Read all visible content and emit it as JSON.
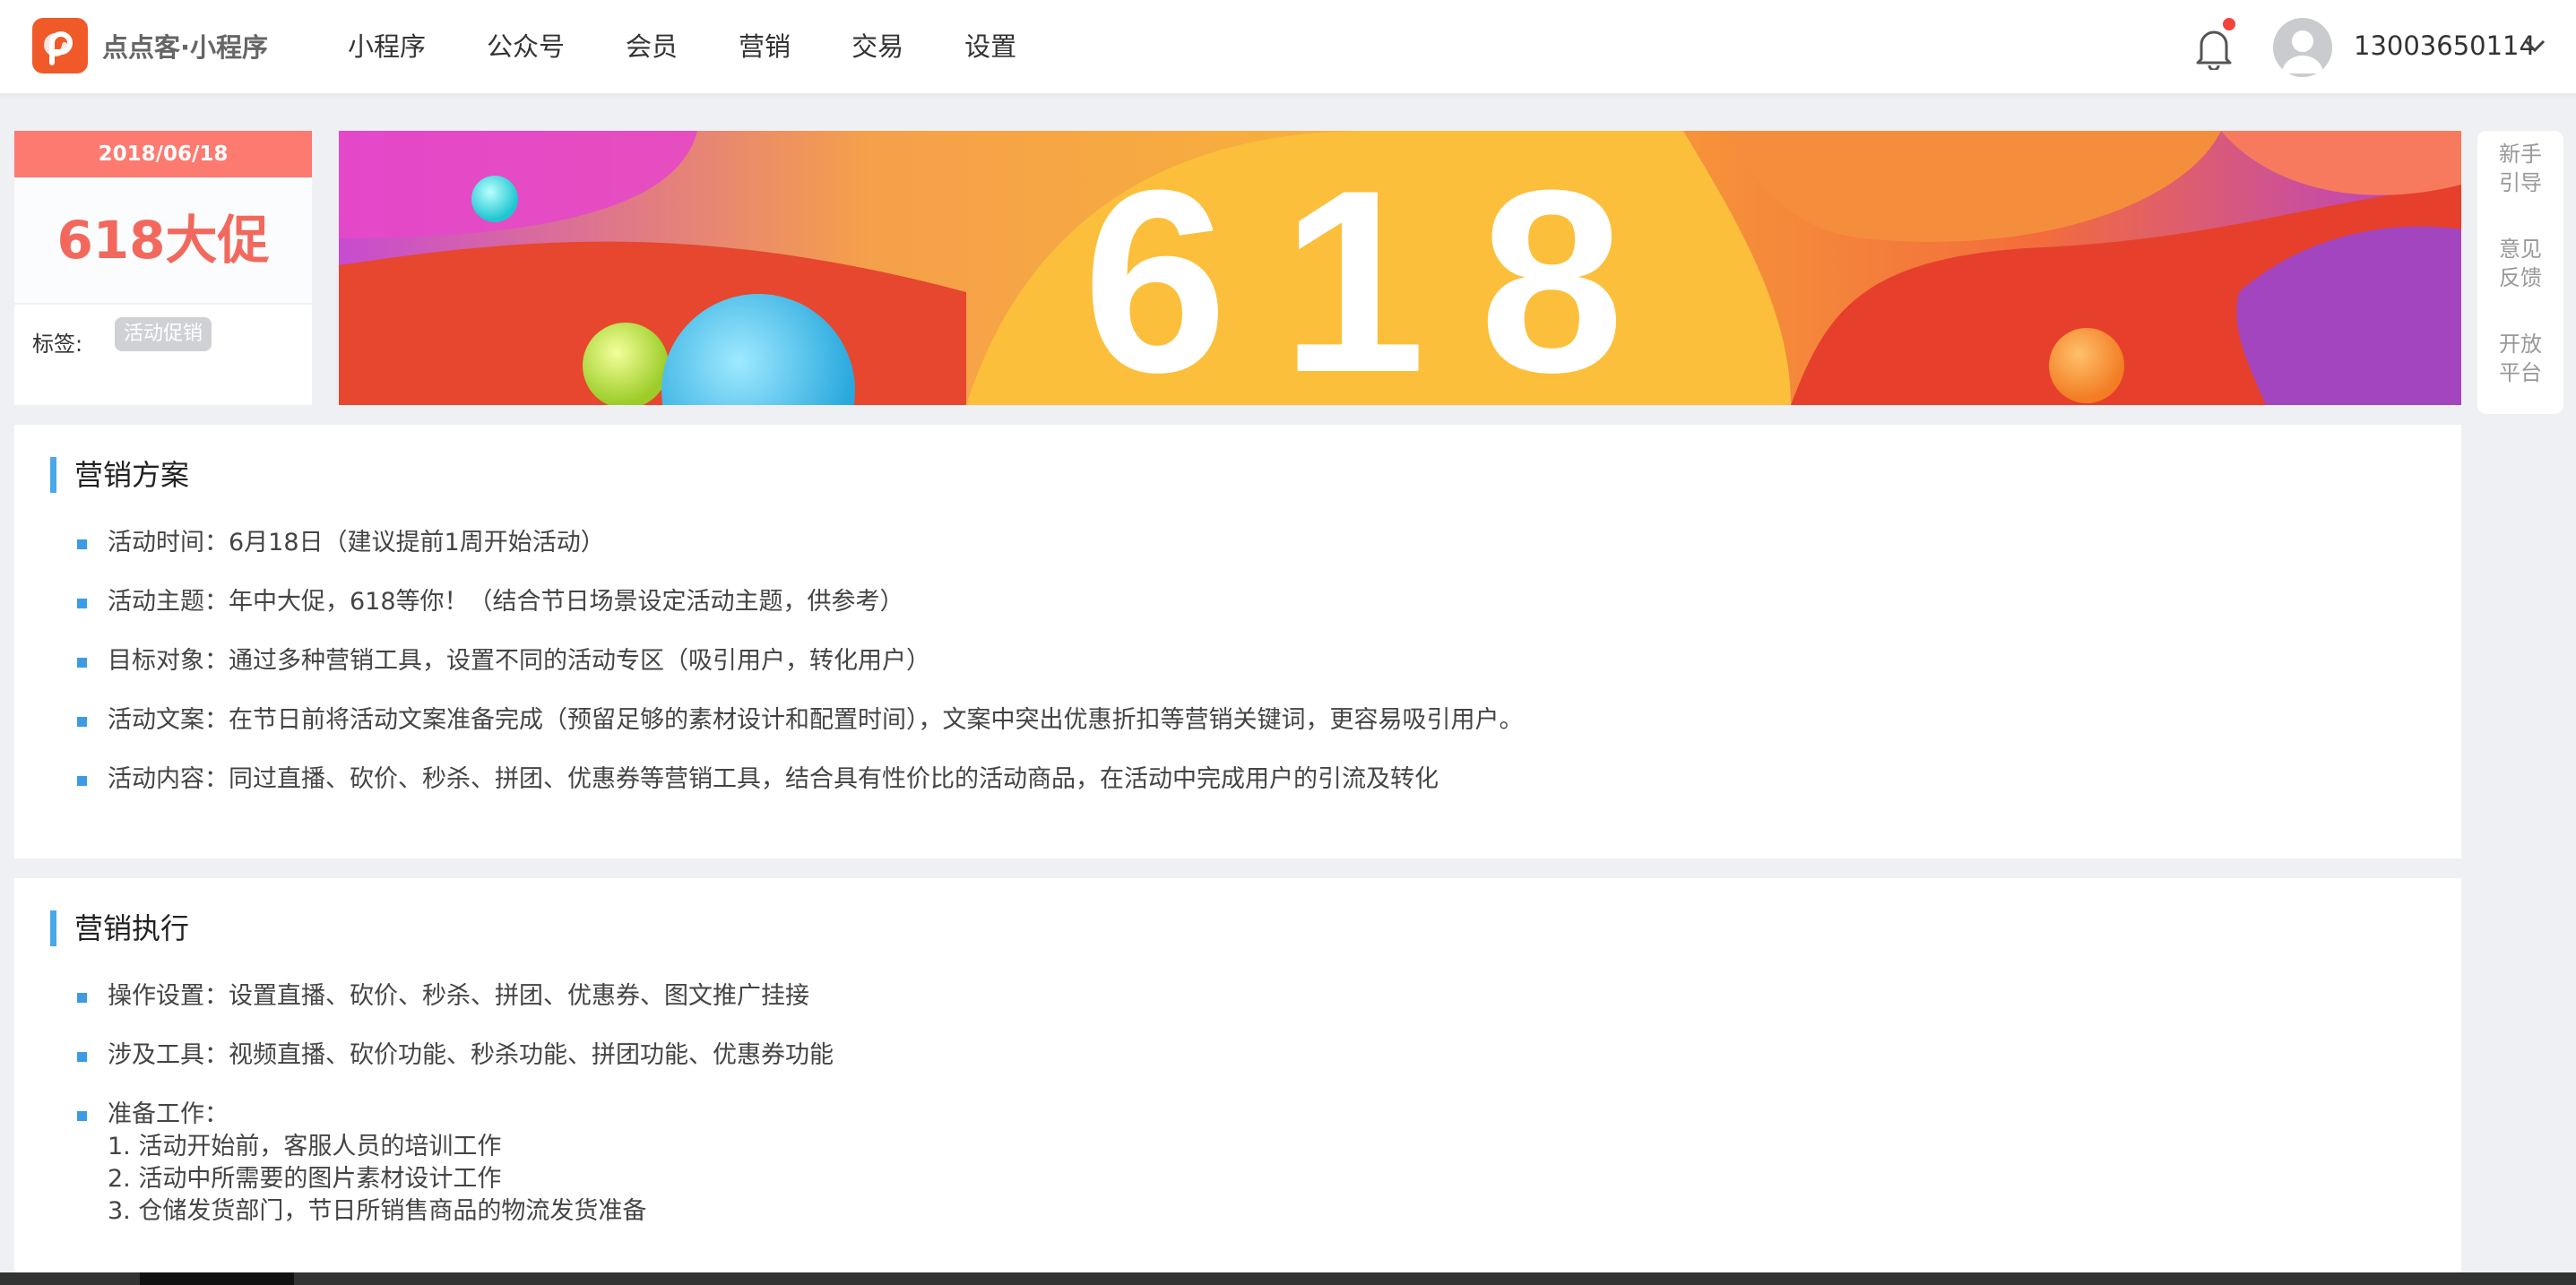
{
  "header": {
    "brand": "点点客·小程序",
    "nav": [
      "小程序",
      "公众号",
      "会员",
      "营销",
      "交易",
      "设置"
    ],
    "user": "13003650114"
  },
  "card": {
    "date": "2018/06/18",
    "title": "618大促",
    "tag_label": "标签:",
    "tag": "活动促销"
  },
  "banner": {
    "text": "618"
  },
  "side": [
    "新手\n引导",
    "意见\n反馈",
    "开放\n平台"
  ],
  "section1": {
    "title": "营销方案",
    "items": [
      "活动时间：6月18日（建议提前1周开始活动）",
      "活动主题：年中大促，618等你！（结合节日场景设定活动主题，供参考）",
      "目标对象：通过多种营销工具，设置不同的活动专区（吸引用户，转化用户）",
      "活动文案：在节日前将活动文案准备完成（预留足够的素材设计和配置时间），文案中突出优惠折扣等营销关键词，更容易吸引用户。",
      "活动内容：同过直播、砍价、秒杀、拼团、优惠券等营销工具，结合具有性价比的活动商品，在活动中完成用户的引流及转化"
    ]
  },
  "section2": {
    "title": "营销执行",
    "items": [
      "操作设置：设置直播、砍价、秒杀、拼团、优惠券、图文推广挂接",
      "涉及工具：视频直播、砍价功能、秒杀功能、拼团功能、优惠券功能",
      "准备工作："
    ],
    "prep": [
      "1. 活动开始前，客服人员的培训工作",
      "2. 活动中所需要的图片素材设计工作",
      "3. 仓储发货部门，节日所销售商品的物流发货准备"
    ]
  },
  "colors": {
    "accent": "#4aa7e8",
    "card_head": "#fc7a70",
    "card_title": "#f2685d",
    "logo": "#f05a28",
    "badge": "#f4433d"
  },
  "icons": [
    "logo-icon",
    "bell-icon",
    "avatar-icon",
    "chevron-down-icon",
    "bullet-icon"
  ]
}
